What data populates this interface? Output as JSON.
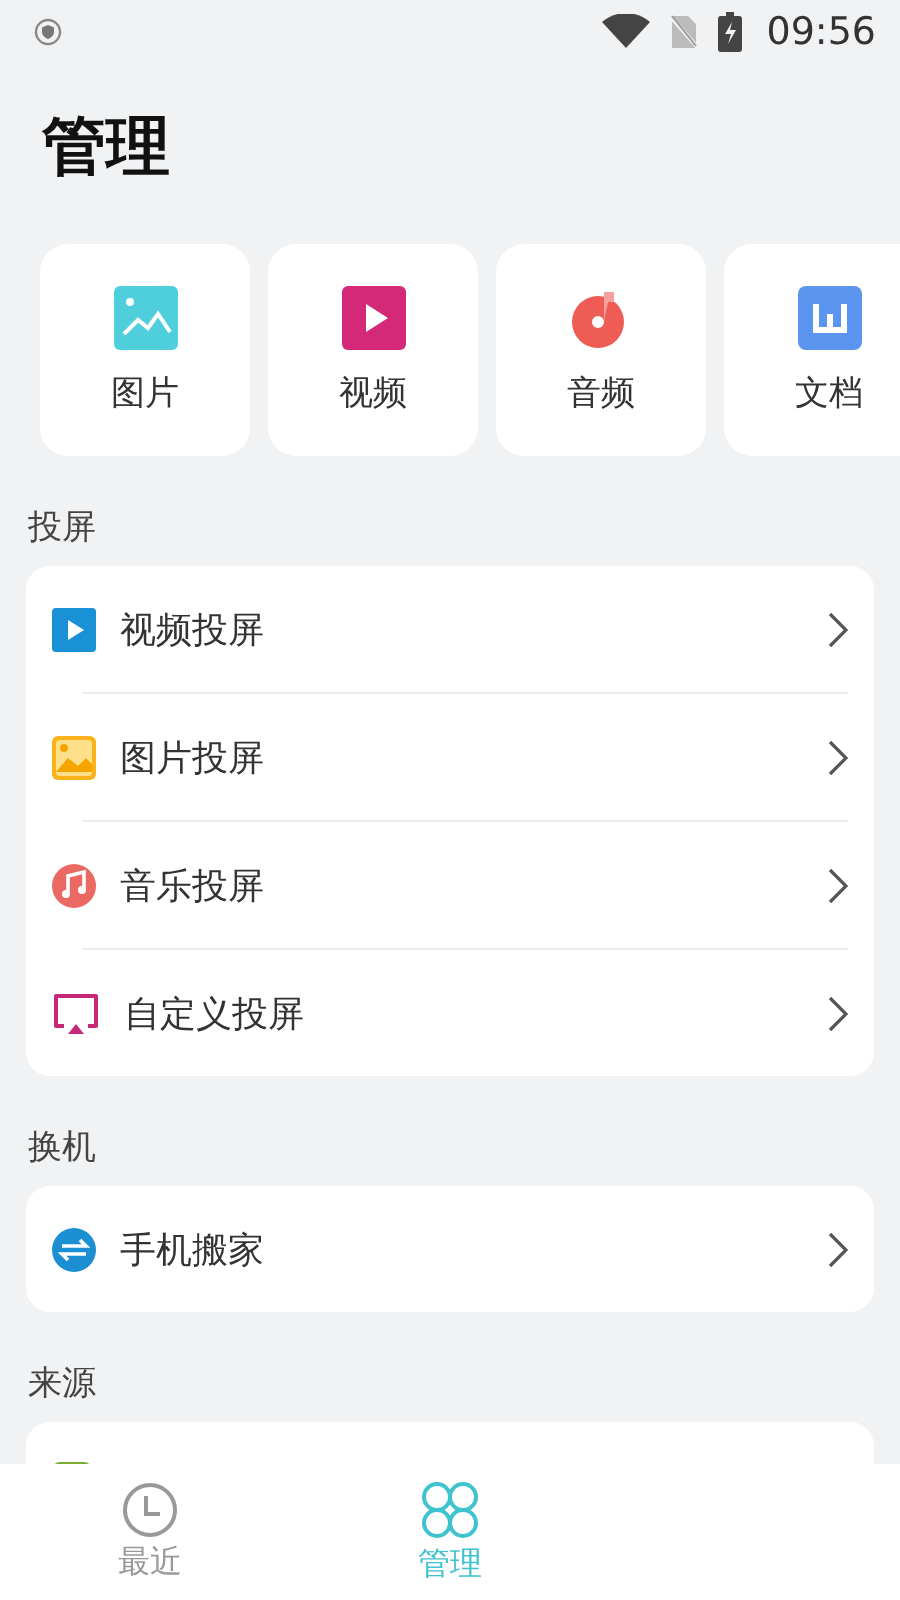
{
  "status_bar": {
    "time": "09:56"
  },
  "title": "管理",
  "categories": [
    {
      "label": "图片",
      "kind": "image"
    },
    {
      "label": "视频",
      "kind": "video"
    },
    {
      "label": "音频",
      "kind": "audio"
    },
    {
      "label": "文档",
      "kind": "document"
    }
  ],
  "sections": [
    {
      "heading": "投屏",
      "items": [
        {
          "label": "视频投屏",
          "kind": "video"
        },
        {
          "label": "图片投屏",
          "kind": "image"
        },
        {
          "label": "音乐投屏",
          "kind": "music"
        },
        {
          "label": "自定义投屏",
          "kind": "cast"
        }
      ]
    },
    {
      "heading": "换机",
      "items": [
        {
          "label": "手机搬家",
          "kind": "transfer"
        }
      ]
    },
    {
      "heading": "来源",
      "items": [
        {
          "kind": "partial"
        }
      ]
    }
  ],
  "tabs": [
    {
      "label": "最近",
      "kind": "recent",
      "selected": false
    },
    {
      "label": "管理",
      "kind": "manage",
      "selected": true
    }
  ]
}
